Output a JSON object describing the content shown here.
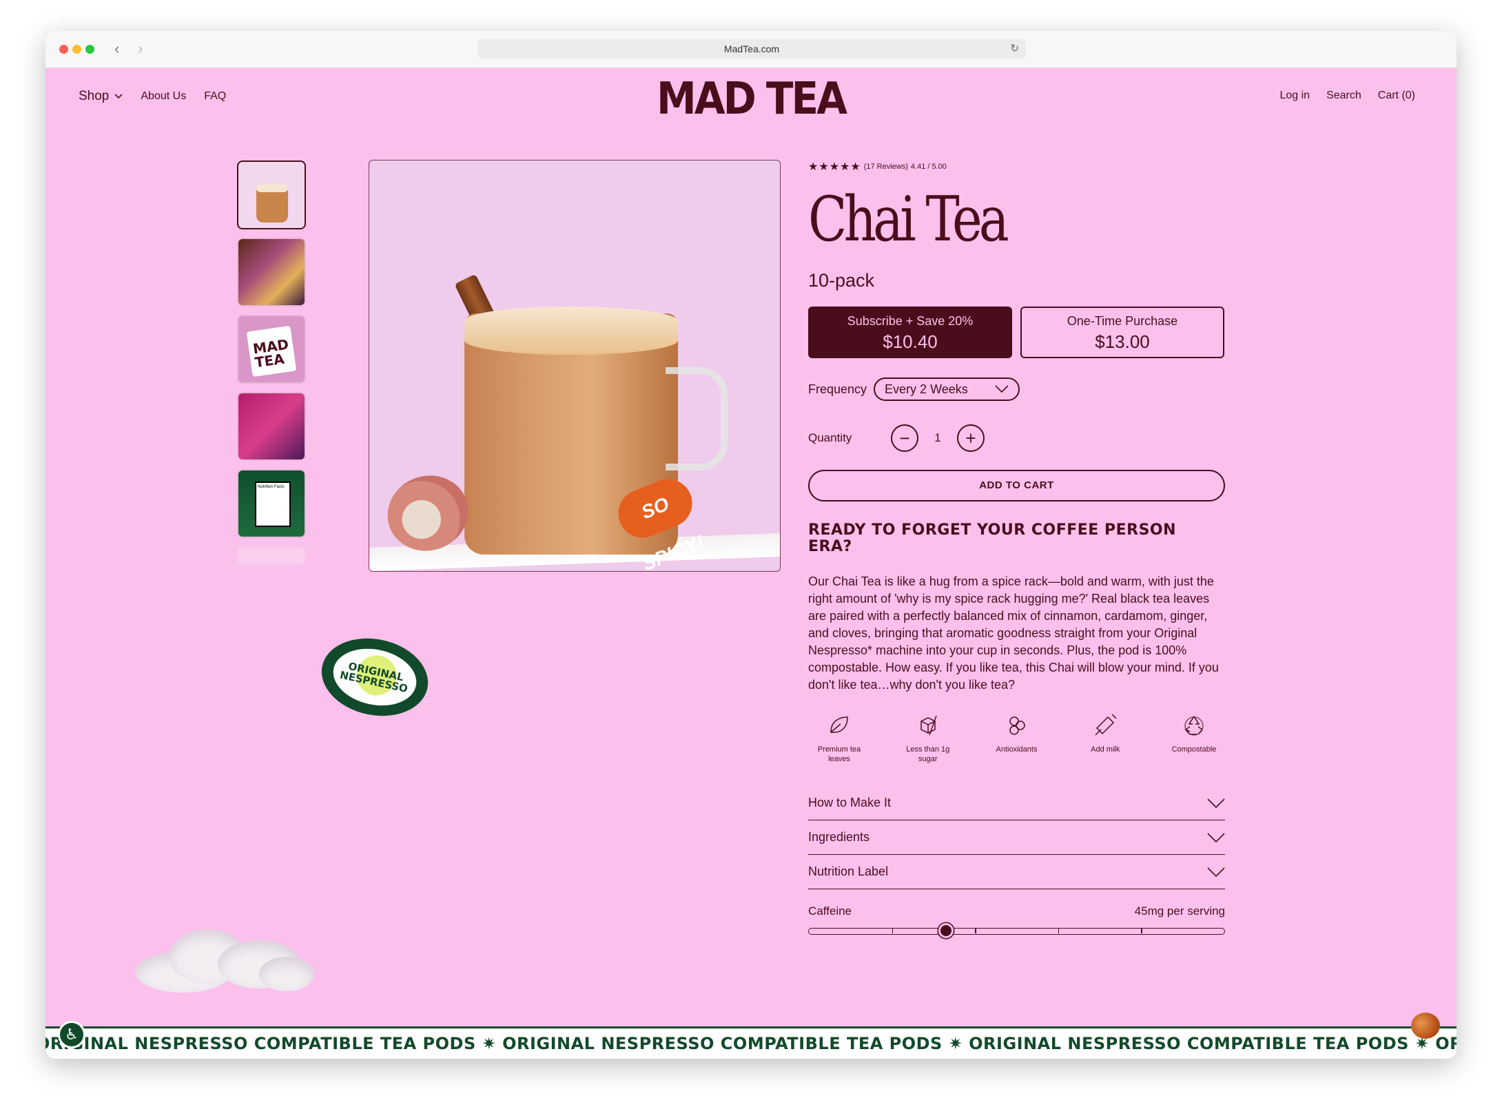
{
  "browser": {
    "url": "MadTea.com",
    "back": "‹",
    "forward": "›",
    "reload": "↻"
  },
  "header": {
    "nav_left": {
      "shop": "Shop",
      "about": "About Us",
      "faq": "FAQ"
    },
    "logo": "MAD TEA",
    "nav_right": {
      "login": "Log in",
      "search": "Search",
      "cart": "Cart (0)"
    }
  },
  "gallery": {
    "thumb3_text": "MAD TEA",
    "thumb5_text": "Nutrition Facts",
    "sticker": "SO SPICY!",
    "badge": "ORIGINAL NESPRESSO",
    "thumb_count": 6
  },
  "product": {
    "rating": {
      "stars": "★★★★★",
      "reviews": "(17 Reviews)",
      "score": "4.41 / 5.00",
      "value": 4.41
    },
    "title": "Chai Tea",
    "pack": "10-pack",
    "subscribe": {
      "label": "Subscribe + Save 20%",
      "price": "$10.40"
    },
    "one_time": {
      "label": "One-Time Purchase",
      "price": "$13.00"
    },
    "frequency": {
      "label": "Frequency",
      "value": "Every 2 Weeks"
    },
    "quantity": {
      "label": "Quantity",
      "value": "1",
      "minus": "−",
      "plus": "+"
    },
    "add_to_cart": "ADD TO CART",
    "headline": "READY TO FORGET YOUR COFFEE PERSON ERA?",
    "description": "Our Chai Tea is like a hug from a spice rack—bold and warm, with just the right amount of 'why is my spice rack hugging me?' Real black tea leaves are paired with a perfectly balanced mix of cinnamon, cardamom, ginger, and cloves, bringing that aromatic goodness straight from your Original Nespresso* machine into your cup in seconds. Plus, the pod is 100% compostable. How easy. If you like tea, this Chai will blow your mind. If you don't like tea…why don't you like tea?",
    "features": [
      {
        "label": "Premium tea leaves",
        "icon": "leaf-icon"
      },
      {
        "label": "Less than 1g sugar",
        "icon": "sugar-cube-icon"
      },
      {
        "label": "Antioxidants",
        "icon": "antioxidant-icon"
      },
      {
        "label": "Add milk",
        "icon": "milk-icon"
      },
      {
        "label": "Compostable",
        "icon": "recycle-icon"
      }
    ],
    "accordions": [
      {
        "label": "How to Make It"
      },
      {
        "label": "Ingredients"
      },
      {
        "label": "Nutrition Label"
      }
    ],
    "caffeine": {
      "label": "Caffeine",
      "value": "45mg per serving",
      "level": 0.33
    }
  },
  "marquee": {
    "text": "ORIGINAL NESPRESSO COMPATIBLE TEA PODS ✷ ORIGINAL NESPRESSO COMPATIBLE TEA PODS ✷ ORIGINAL NESPRESSO COMPATIBLE TEA PODS ✷ ORIGINAL NESPRESSO COMPATIBLE TEA PODS ✷ ORIGINAL NESPRESSO COMPATIBLE"
  },
  "colors": {
    "background": "#fcc0ec",
    "brand": "#4a0d1c",
    "green": "#114a2a"
  }
}
